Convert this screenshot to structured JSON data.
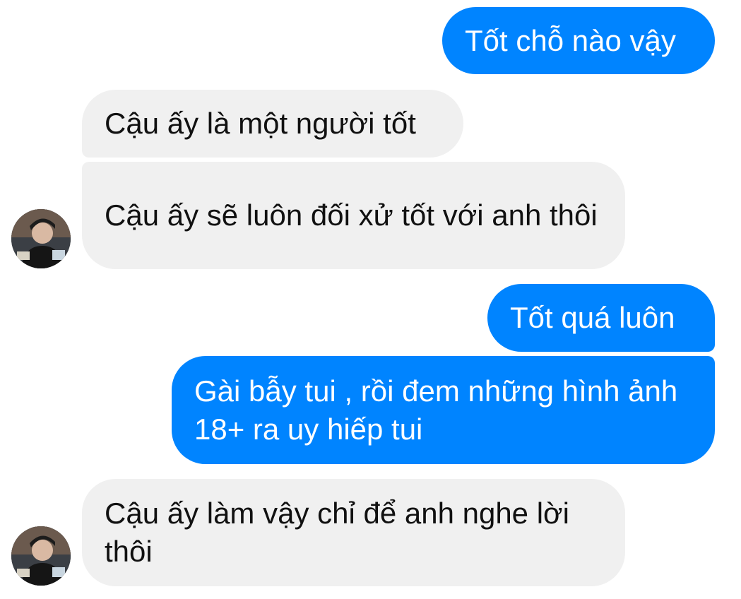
{
  "messages": [
    {
      "direction": "outgoing",
      "text": "Tốt chỗ nào vậy"
    },
    {
      "direction": "incoming",
      "text": "Cậu ấy là một người tốt"
    },
    {
      "direction": "incoming",
      "text": "Cậu ấy sẽ luôn đối xử tốt với anh thôi"
    },
    {
      "direction": "outgoing",
      "text": "Tốt quá luôn"
    },
    {
      "direction": "outgoing",
      "text": "Gài bẫy tui , rồi đem những hình ảnh 18+ ra uy hiếp tui"
    },
    {
      "direction": "incoming",
      "text": "Cậu ấy làm vậy chỉ để anh nghe lời thôi"
    }
  ],
  "colors": {
    "outgoing_bubble": "#0084ff",
    "incoming_bubble": "#f0f0f0",
    "outgoing_text": "#ffffff",
    "incoming_text": "#111111"
  },
  "icons": {
    "contact_avatar": "contact-avatar-icon"
  }
}
